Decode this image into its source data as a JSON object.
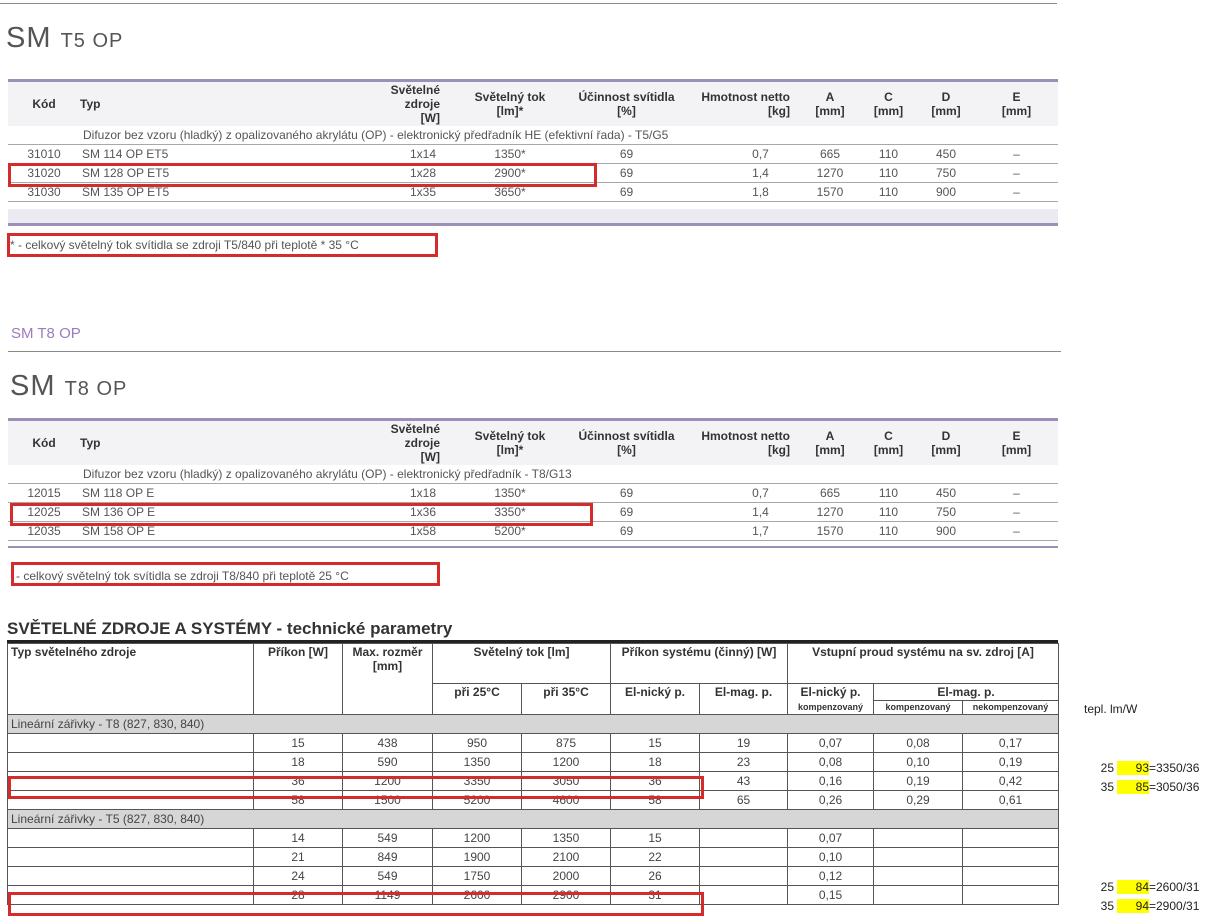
{
  "section1": {
    "title_main": "SM",
    "title_sub": "T5 OP",
    "columns": [
      "Kód",
      "Typ",
      "Světelné zdroje [W]",
      "Světelný tok [lm]*",
      "Účinnost svítidla [%]",
      "Hmotnost netto [kg]",
      "A [mm]",
      "C [mm]",
      "D [mm]",
      "E [mm]"
    ],
    "col_lines": [
      [
        "Kód"
      ],
      [
        "Typ"
      ],
      [
        "Světelné zdroje",
        "[W]"
      ],
      [
        "Světelný tok",
        "[lm]*"
      ],
      [
        "Účinnost svítidla",
        "[%]"
      ],
      [
        "Hmotnost netto",
        "[kg]"
      ],
      [
        "A",
        "[mm]"
      ],
      [
        "C",
        "[mm]"
      ],
      [
        "D",
        "[mm]"
      ],
      [
        "E",
        "[mm]"
      ]
    ],
    "description": "Difuzor bez vzoru (hladký) z opalizovaného akrylátu (OP) - elektronický předřadník HE (efektivní řada) - T5/G5",
    "rows": [
      [
        "31010",
        "SM 114 OP ET5",
        "1x14",
        "1350*",
        "69",
        "0,7",
        "665",
        "110",
        "450",
        "–"
      ],
      [
        "31020",
        "SM 128 OP ET5",
        "1x28",
        "2900*",
        "69",
        "1,4",
        "1270",
        "110",
        "750",
        "–"
      ],
      [
        "31030",
        "SM 135 OP ET5",
        "1x35",
        "3650*",
        "69",
        "1,8",
        "1570",
        "110",
        "900",
        "–"
      ]
    ],
    "footnote": "* - celkový světelný tok svítidla se zdroji T5/840 při teplotě * 35 °C"
  },
  "section2": {
    "small_heading": "SM T8 OP",
    "title_main": "SM",
    "title_sub": "T8 OP",
    "col_lines": [
      [
        "Kód"
      ],
      [
        "Typ"
      ],
      [
        "Světelné zdroje",
        "[W]"
      ],
      [
        "Světelný tok",
        "[lm]*"
      ],
      [
        "Účinnost svítidla",
        "[%]"
      ],
      [
        "Hmotnost netto",
        "[kg]"
      ],
      [
        "A",
        "[mm]"
      ],
      [
        "C",
        "[mm]"
      ],
      [
        "D",
        "[mm]"
      ],
      [
        "E",
        "[mm]"
      ]
    ],
    "description": "Difuzor bez vzoru (hladký) z opalizovaného akrylátu (OP) - elektronický předřadník - T8/G13",
    "rows": [
      [
        "12015",
        "SM 118 OP E",
        "1x18",
        "1350*",
        "69",
        "0,7",
        "665",
        "110",
        "450",
        "–"
      ],
      [
        "12025",
        "SM 136 OP E",
        "1x36",
        "3350*",
        "69",
        "1,4",
        "1270",
        "110",
        "750",
        "–"
      ],
      [
        "12035",
        "SM 158 OP E",
        "1x58",
        "5200*",
        "69",
        "1,7",
        "1570",
        "110",
        "900",
        "–"
      ]
    ],
    "footnote": "- celkový světelný tok svítidla se zdroji T8/840 při teplotě 25 °C"
  },
  "tech": {
    "title": "SVĚTELNÉ ZDROJE A SYSTÉMY - technické parametry",
    "headers": {
      "typ": "Typ světelného zdroje",
      "prikon": "Příkon [W]",
      "max": "Max. rozměr [mm]",
      "tok": "Světelný tok [lm]",
      "prikon_sys": "Příkon systému (činný) [W]",
      "proud": "Vstupní proud systému na sv. zdroj [A]",
      "t25": "při 25°C",
      "t35": "při 35°C",
      "elnicky": "El-nický p.",
      "elmag": "El-mag. p.",
      "elnicky2": "El-nický p.",
      "elmag2": "El-mag. p.",
      "komp": "kompenzovaný",
      "komp2": "kompenzovaný",
      "nekomp": "nekompenzovaný"
    },
    "groups": [
      {
        "label": "Lineární zářivky - T8 (827, 830, 840)",
        "rows": [
          [
            "15",
            "438",
            "950",
            "875",
            "15",
            "19",
            "0,07",
            "0,08",
            "0,17"
          ],
          [
            "18",
            "590",
            "1350",
            "1200",
            "18",
            "23",
            "0,08",
            "0,10",
            "0,19"
          ],
          [
            "36",
            "1200",
            "3350",
            "3050",
            "36",
            "43",
            "0,16",
            "0,19",
            "0,42"
          ],
          [
            "58",
            "1500",
            "5200",
            "4600",
            "58",
            "65",
            "0,26",
            "0,29",
            "0,61"
          ]
        ]
      },
      {
        "label": "Lineární zářivky - T5 (827, 830, 840)",
        "rows": [
          [
            "14",
            "549",
            "1200",
            "1350",
            "15",
            "",
            "0,07",
            "",
            ""
          ],
          [
            "21",
            "849",
            "1900",
            "2100",
            "22",
            "",
            "0,10",
            "",
            ""
          ],
          [
            "24",
            "549",
            "1750",
            "2000",
            "26",
            "",
            "0,12",
            "",
            ""
          ],
          [
            "28",
            "1149",
            "2600",
            "2900",
            "31",
            "",
            "0,15",
            "",
            ""
          ]
        ]
      }
    ]
  },
  "side_notes": {
    "header": "tepl. lm/W",
    "rows": [
      {
        "t": "25",
        "v": "93",
        "f": "=3350/36"
      },
      {
        "t": "35",
        "v": "85",
        "f": "=3050/36"
      },
      {
        "t": "25",
        "v": "84",
        "f": "=2600/31"
      },
      {
        "t": "35",
        "v": "94",
        "f": "=2900/31"
      }
    ]
  },
  "colors": {
    "highlight_box": "#d42b2b",
    "accent_rule": "#9b8fb8",
    "cell_highlight": "#ffff00"
  }
}
